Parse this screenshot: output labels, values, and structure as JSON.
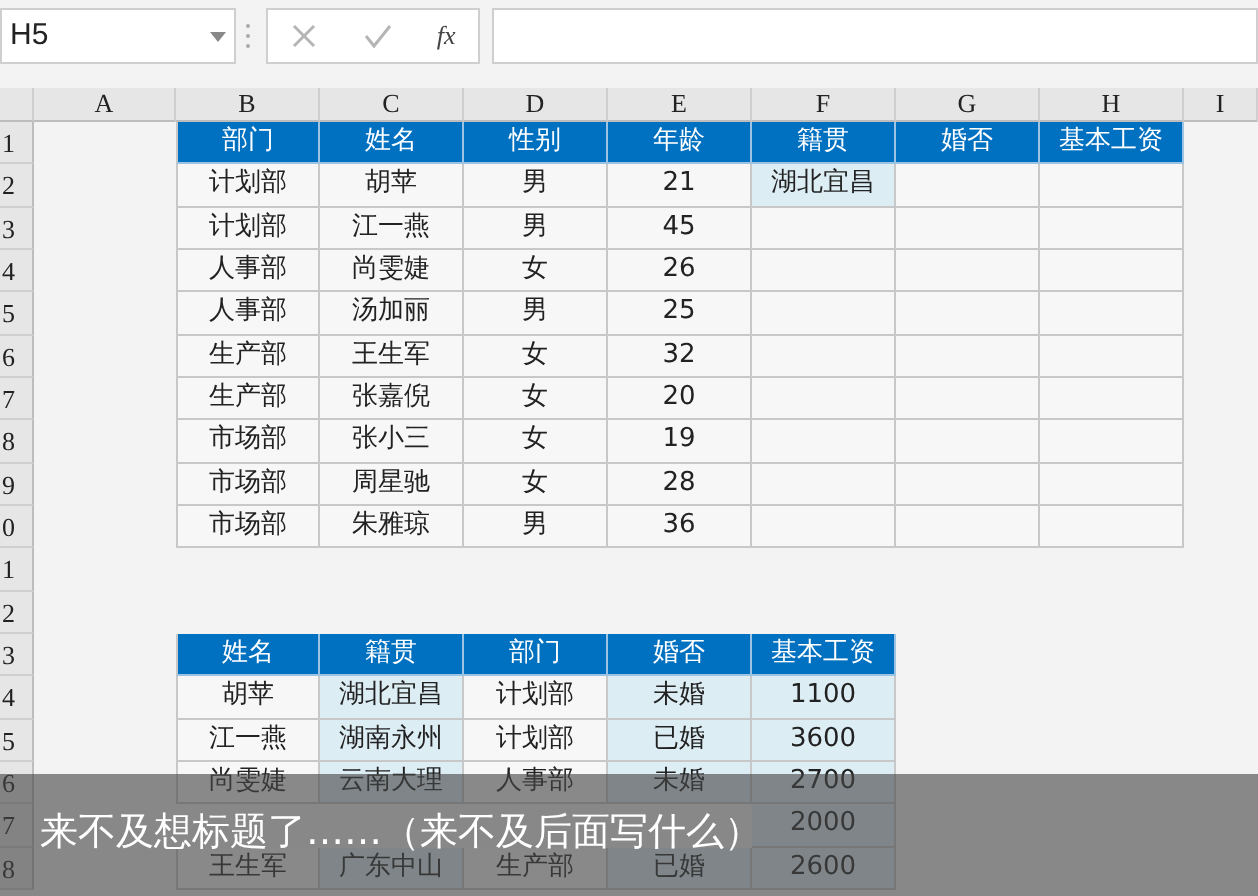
{
  "name_box": {
    "value": "H5"
  },
  "formula_bar": {
    "function_label": "fx"
  },
  "column_headers": [
    "A",
    "B",
    "C",
    "D",
    "E",
    "F",
    "G",
    "H",
    "I"
  ],
  "row_headers": [
    "1",
    "2",
    "3",
    "4",
    "5",
    "6",
    "7",
    "8",
    "9",
    "0",
    "1",
    "2",
    "3",
    "4",
    "5",
    "6",
    "7",
    "8"
  ],
  "table_1": {
    "columns": [
      "部门",
      "姓名",
      "性别",
      "年龄",
      "籍贯",
      "婚否",
      "基本工资"
    ],
    "rows": [
      {
        "cells": [
          "计划部",
          "胡苹",
          "男",
          "21"
        ],
        "origin": {
          "text": "湖北宜昌",
          "highlighted": true
        }
      },
      {
        "cells": [
          "计划部",
          "江一燕",
          "男",
          "45"
        ]
      },
      {
        "cells": [
          "人事部",
          "尚雯婕",
          "女",
          "26"
        ]
      },
      {
        "cells": [
          "人事部",
          "汤加丽",
          "男",
          "25"
        ]
      },
      {
        "cells": [
          "生产部",
          "王生军",
          "女",
          "32"
        ]
      },
      {
        "cells": [
          "生产部",
          "张嘉倪",
          "女",
          "20"
        ]
      },
      {
        "cells": [
          "市场部",
          "张小三",
          "女",
          "19"
        ]
      },
      {
        "cells": [
          "市场部",
          "周星驰",
          "女",
          "28"
        ]
      },
      {
        "cells": [
          "市场部",
          "朱雅琼",
          "男",
          "36"
        ]
      }
    ]
  },
  "table_2": {
    "columns": [
      {
        "label": "姓名",
        "highlighted": false
      },
      {
        "label": "籍贯",
        "highlighted": true
      },
      {
        "label": "部门",
        "highlighted": false
      },
      {
        "label": "婚否",
        "highlighted": true
      },
      {
        "label": "基本工资",
        "highlighted": true
      }
    ],
    "rows": [
      [
        "胡苹",
        "湖北宜昌",
        "计划部",
        "未婚",
        "1100"
      ],
      [
        "江一燕",
        "湖南永州",
        "计划部",
        "已婚",
        "3600"
      ],
      [
        "尚雯婕",
        "云南大理",
        "人事部",
        "未婚",
        "2700"
      ],
      [
        null,
        null,
        null,
        null,
        "2000"
      ],
      [
        "王生军",
        "广东中山",
        "生产部",
        "已婚",
        "2600"
      ]
    ]
  },
  "caption": {
    "text": "来不及想标题了……（来不及后面写什么）"
  }
}
